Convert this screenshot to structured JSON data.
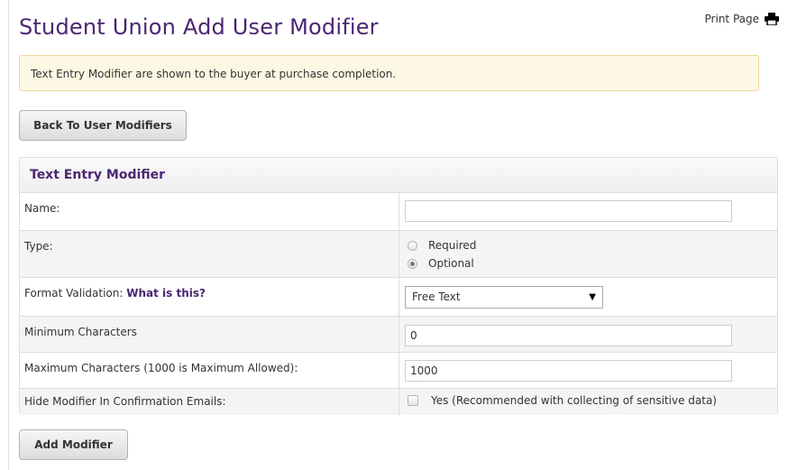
{
  "page": {
    "title": "Student Union Add User Modifier",
    "print_label": "Print Page",
    "print_icon": "printer-icon"
  },
  "alert": {
    "text": "Text Entry Modifier are shown to the buyer at purchase completion."
  },
  "buttons": {
    "back_label": "Back To User Modifiers",
    "add_label": "Add Modifier"
  },
  "panel": {
    "heading": "Text Entry Modifier",
    "name": {
      "label": "Name:",
      "value": ""
    },
    "type": {
      "label": "Type:",
      "options": [
        "Required",
        "Optional"
      ],
      "selected": "Optional"
    },
    "format": {
      "label": "Format Validation:",
      "help_link": "What is this?",
      "selected": "Free Text"
    },
    "min_chars": {
      "label": "Minimum Characters",
      "value": "0"
    },
    "max_chars": {
      "label": "Maximum Characters (1000 is Maximum Allowed):",
      "value": "1000"
    },
    "hide": {
      "label": "Hide Modifier In Confirmation Emails:",
      "option": "Yes (Recommended with collecting of sensitive data)",
      "checked": false
    }
  },
  "colors": {
    "title": "#4b2670",
    "alert_bg": "#fcf8e3",
    "alert_border": "#f2d59d"
  }
}
